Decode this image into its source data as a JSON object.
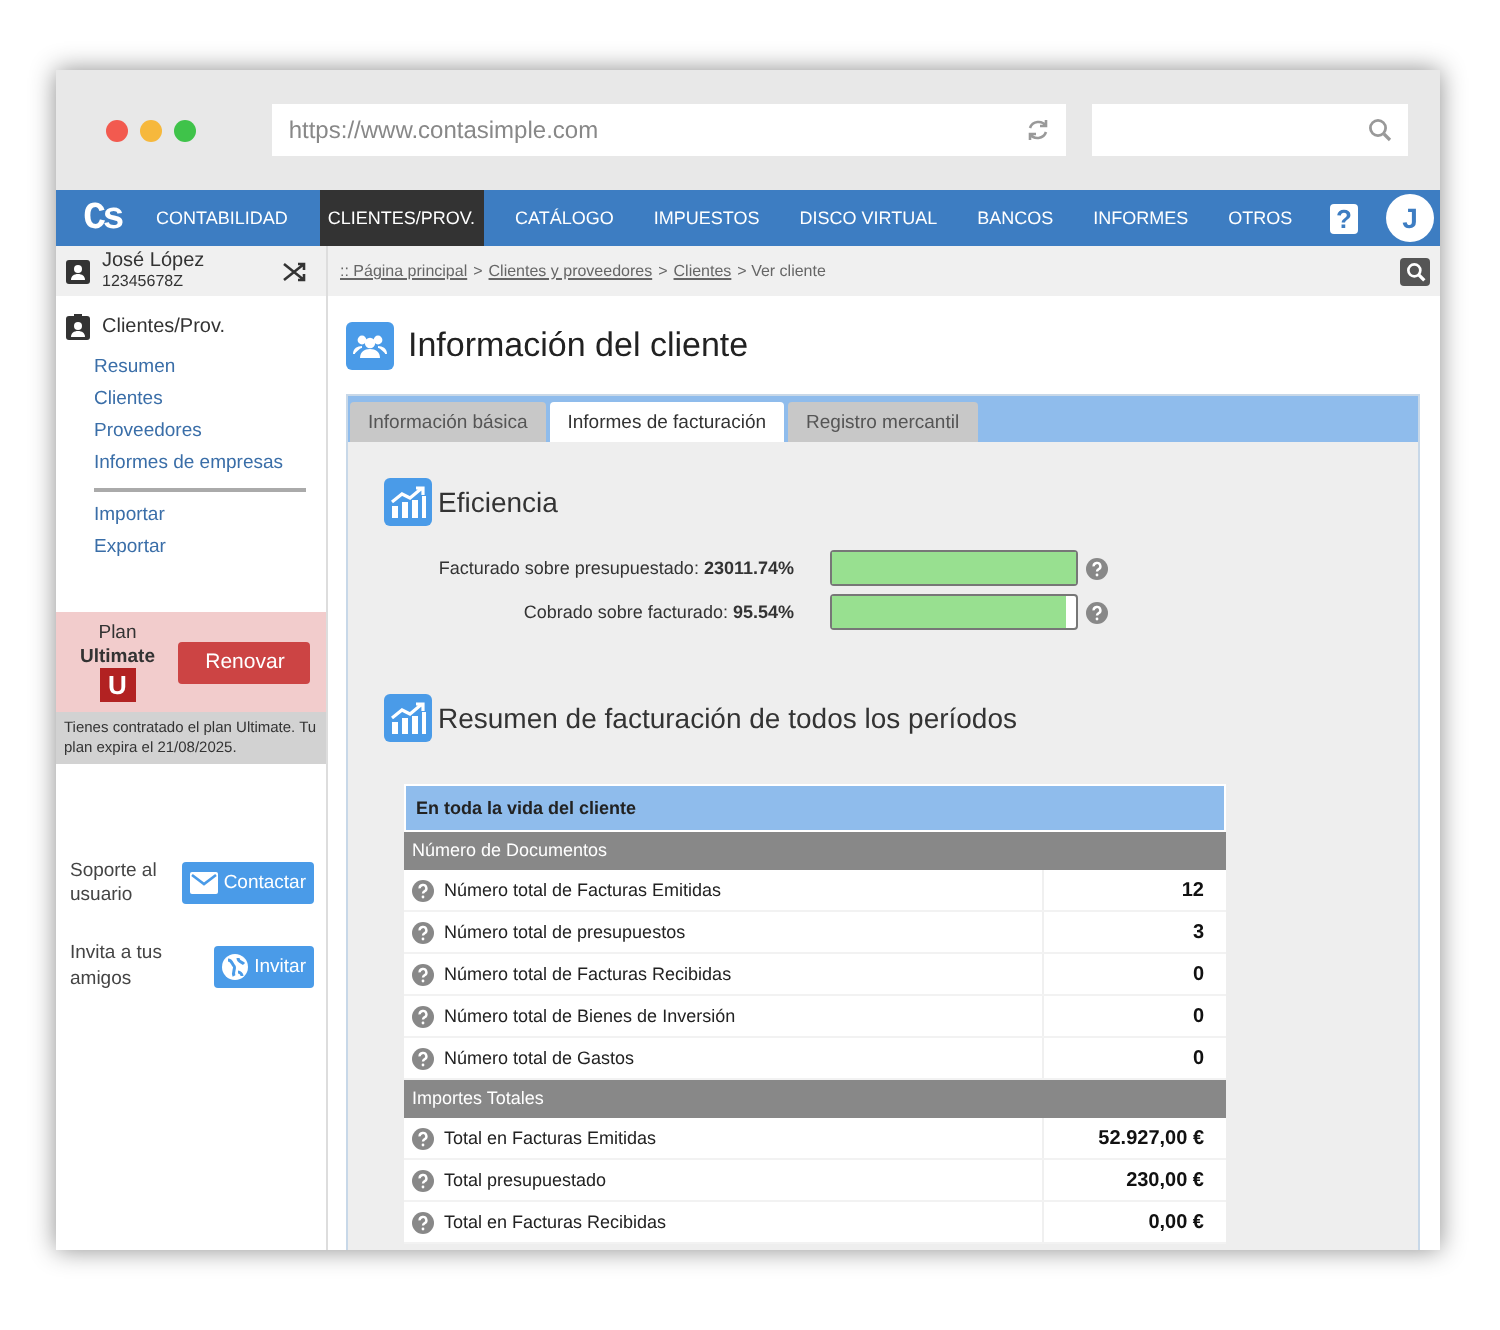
{
  "browser": {
    "url": "https://www.contasimple.com"
  },
  "logo": "Cs",
  "nav": [
    {
      "label": "CONTABILIDAD",
      "selected": false
    },
    {
      "label": "CLIENTES/PROV.",
      "selected": true
    },
    {
      "label": "CATÁLOGO",
      "selected": false
    },
    {
      "label": "IMPUESTOS",
      "selected": false
    },
    {
      "label": "DISCO VIRTUAL",
      "selected": false
    },
    {
      "label": "BANCOS",
      "selected": false
    },
    {
      "label": "INFORMES",
      "selected": false
    },
    {
      "label": "OTROS",
      "selected": false
    }
  ],
  "help": "?",
  "avatar": "J",
  "user": {
    "name": "José López",
    "id": "12345678Z"
  },
  "breadcrumb": [
    {
      "label": ":: Página principal",
      "link": true
    },
    {
      "label": ">",
      "link": false
    },
    {
      "label": "Clientes y proveedores",
      "link": true
    },
    {
      "label": ">",
      "link": false
    },
    {
      "label": "Clientes",
      "link": true
    },
    {
      "label": "> Ver cliente",
      "link": false
    }
  ],
  "sidebar": {
    "title": "Clientes/Prov.",
    "groups": [
      [
        "Resumen",
        "Clientes",
        "Proveedores",
        "Informes de empresas"
      ],
      [
        "Importar",
        "Exportar"
      ]
    ]
  },
  "plan": {
    "label": "Plan",
    "name": "Ultimate",
    "badge": "U",
    "button": "Renovar",
    "note": "Tienes contratado el plan Ultimate. Tu plan expira el 21/08/2025."
  },
  "support": [
    {
      "text": "Soporte al usuario",
      "button": "Contactar",
      "kind": "mail"
    },
    {
      "text": "Invita a tus amigos",
      "button": "Invitar",
      "kind": "globe"
    }
  ],
  "page_title": "Información del cliente",
  "tabs": [
    {
      "label": "Información básica",
      "selected": false
    },
    {
      "label": "Informes de facturación",
      "selected": true
    },
    {
      "label": "Registro mercantil",
      "selected": false
    }
  ],
  "efficiency": {
    "title": "Eficiencia",
    "meters": [
      {
        "label": "Facturado sobre presupuestado:",
        "value": "23011.74%",
        "level": 1
      },
      {
        "label": "Cobrado sobre facturado:",
        "value": "95.54%",
        "level": 0.955
      }
    ]
  },
  "summary": {
    "title": "Resumen de facturación de todos los períodos",
    "table_title": "En toda la vida del cliente",
    "sections": [
      {
        "title": "Número de Documentos",
        "rows": [
          [
            "Número total de Facturas Emitidas",
            "12"
          ],
          [
            "Número total de presupuestos",
            "3"
          ],
          [
            "Número total de Facturas Recibidas",
            "0"
          ],
          [
            "Número total de Bienes de Inversión",
            "0"
          ],
          [
            "Número total de Gastos",
            "0"
          ]
        ]
      },
      {
        "title": "Importes Totales",
        "rows": [
          [
            "Total en Facturas Emitidas",
            "52.927,00 €"
          ],
          [
            "Total presupuestado",
            "230,00 €"
          ],
          [
            "Total en Facturas Recibidas",
            "0,00 €"
          ]
        ]
      }
    ]
  }
}
